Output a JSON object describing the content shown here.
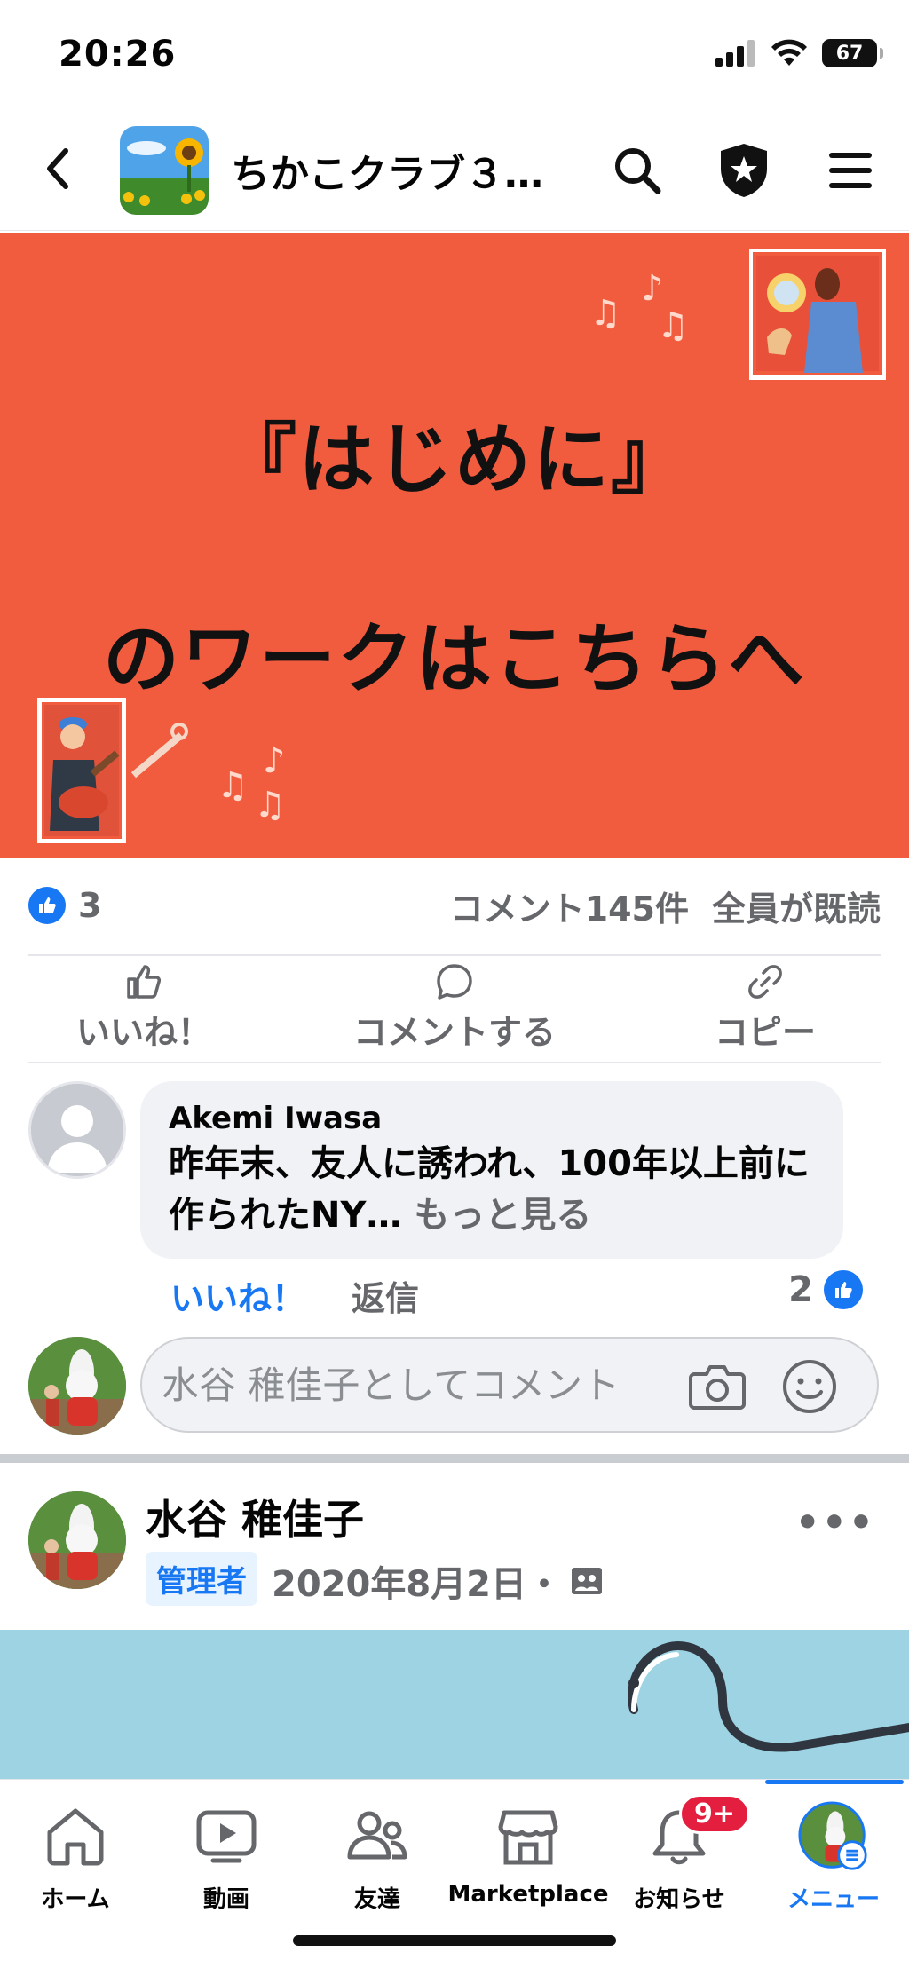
{
  "status_bar": {
    "time": "20:26",
    "battery": "67"
  },
  "header": {
    "group_name": "ちかこクラブ３…"
  },
  "banner": {
    "line1": "『はじめに』",
    "line2": "のワークはこちらへ"
  },
  "reactions": {
    "like_count": "3",
    "comments": "コメント145件",
    "seen": "全員が既読"
  },
  "actions": {
    "like": "いいね！",
    "comment": "コメントする",
    "copy": "コピー"
  },
  "comment": {
    "author": "Akemi Iwasa",
    "text": "昨年末、友人に誘われ、100年以上前に作られたNY…",
    "more": " もっと見る",
    "like_label": "いいね！",
    "reply_label": "返信",
    "like_count": "2"
  },
  "comment_input": {
    "placeholder": "水谷 稚佳子としてコメント"
  },
  "next_post": {
    "author": "水谷 稚佳子",
    "badge": "管理者",
    "date": "2020年8月2日・"
  },
  "nav": {
    "items": [
      {
        "label": "ホーム",
        "icon": "home-icon"
      },
      {
        "label": "動画",
        "icon": "video-icon"
      },
      {
        "label": "友達",
        "icon": "friends-icon"
      },
      {
        "label": "Marketplace",
        "icon": "marketplace-icon"
      },
      {
        "label": "お知らせ",
        "icon": "bell-icon",
        "badge": "9+"
      },
      {
        "label": "メニュー",
        "icon": "menu-avatar-icon",
        "active": true
      }
    ]
  },
  "colors": {
    "brand": "#1877f2",
    "banner": "#f15b3e",
    "badge": "#e41e3f"
  }
}
